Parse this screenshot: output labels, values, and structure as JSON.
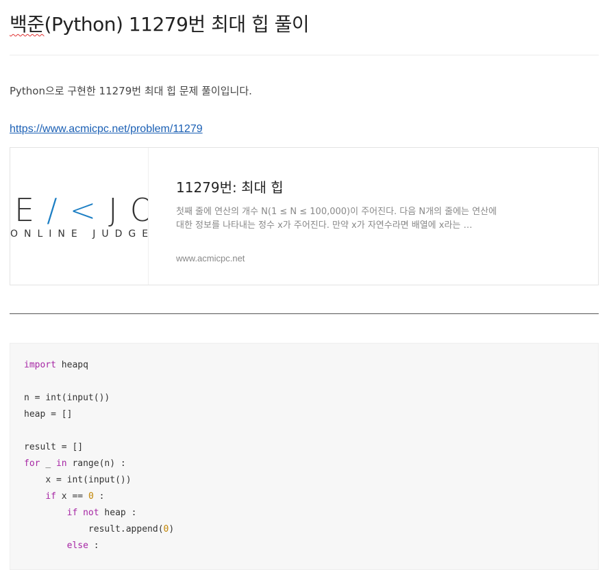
{
  "post": {
    "title_prefix": "백준",
    "title_rest": "(Python) 11279번 최대 힙 풀이",
    "intro": "Python으로 구현한 11279번 최대 힙 문제 풀이입니다.",
    "link": "https://www.acmicpc.net/problem/11279"
  },
  "card": {
    "logo_line1_a": "E",
    "logo_line1_b": "/<",
    "logo_line1_c": "JOC",
    "logo_line2": "ONLINE JUDGE",
    "title": "11279번: 최대 힙",
    "description": "첫째 줄에 연산의 개수 N(1 ≤ N ≤ 100,000)이 주어진다. 다음 N개의 줄에는 연산에 대한 정보를 나타내는 정수 x가 주어진다. 만약 x가 자연수라면 배열에 x라는 …",
    "host": "www.acmicpc.net"
  },
  "code": {
    "language": "python",
    "lines": [
      "import heapq",
      "",
      "n = int(input())",
      "heap = []",
      "",
      "result = []",
      "for _ in range(n) :",
      "    x = int(input())",
      "    if x == 0 :",
      "        if not heap :",
      "            result.append(0)",
      "        else :"
    ]
  },
  "colors": {
    "link": "#1a5fb4",
    "keyword": "#a626a4",
    "number": "#c18401",
    "logo_accent": "#1d7fc4"
  }
}
